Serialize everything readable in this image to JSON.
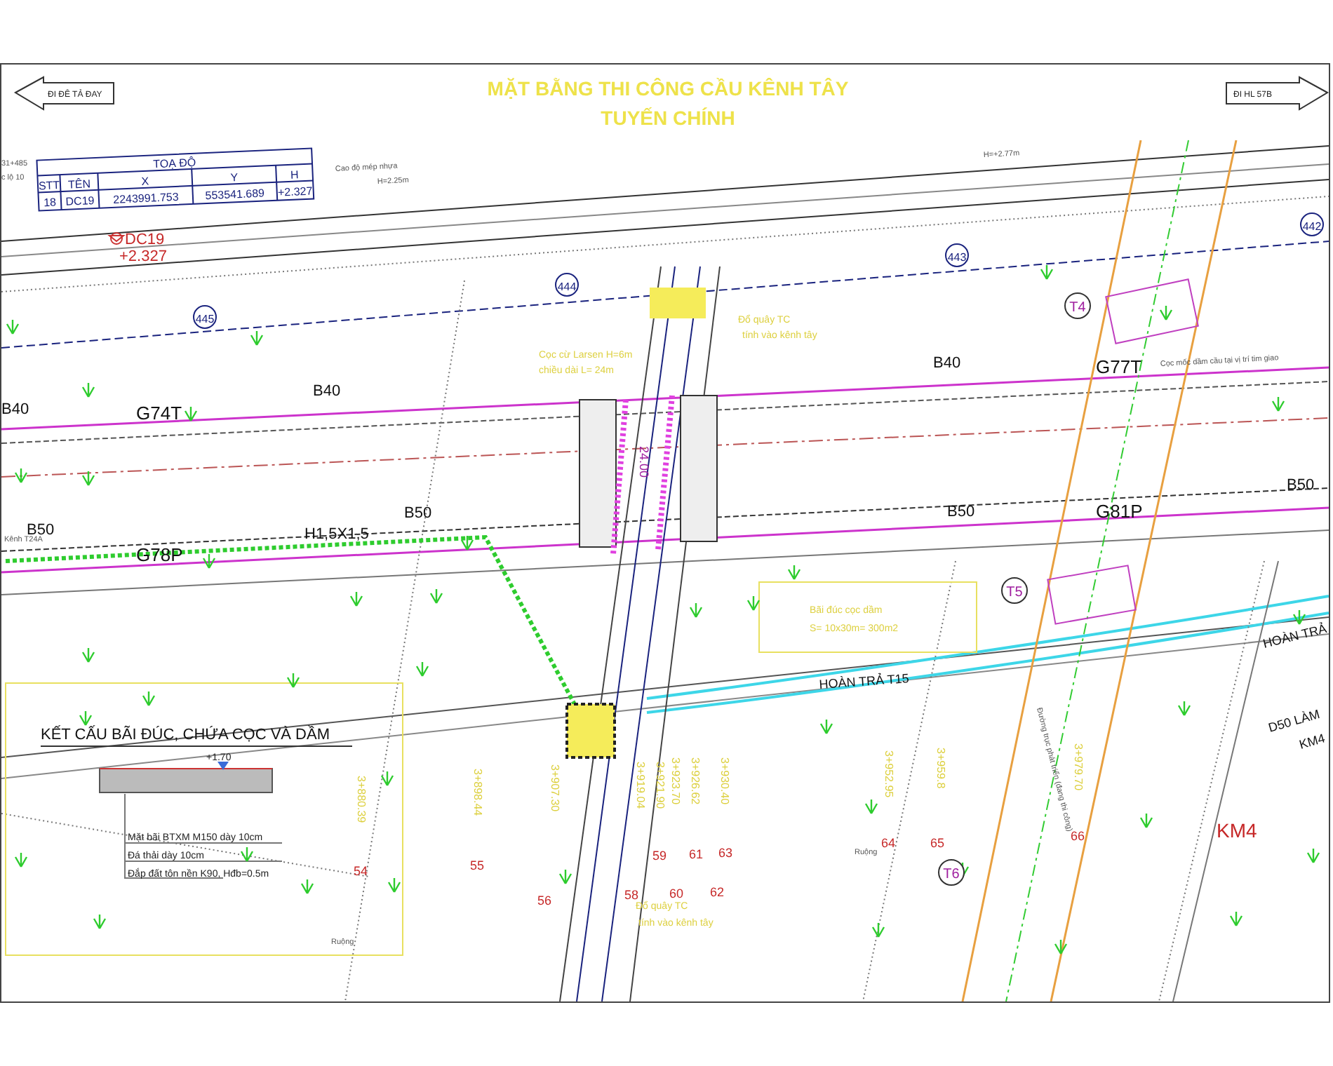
{
  "title": {
    "main": "MẶT BẰNG THI CÔNG CẦU KÊNH TÂY",
    "sub": "TUYẾN CHÍNH"
  },
  "direction_signs": [
    {
      "label": "ĐI ĐÊ TẢ ĐAY",
      "kind": "left"
    },
    {
      "label": "ĐI HL 57B",
      "kind": "right"
    }
  ],
  "coordinate_table": {
    "title": "TOẠ ĐỘ",
    "columns": [
      "STT",
      "TÊN",
      "X",
      "Y",
      "H"
    ],
    "rows": [
      [
        "18",
        "DC19",
        "2243991.753",
        "553541.689",
        "+2.327"
      ]
    ]
  },
  "survey_point": {
    "name": "DC19",
    "elevation": "+2.327"
  },
  "notes": [
    "31+485",
    "c lộ 10",
    "Cao độ mép nhựa",
    "H=2.25m",
    "H=+2.77m",
    "Cọc mốc dầm cầu tại vị trí tim giao",
    "Kênh T24A",
    "Ruộng",
    "Ruộng",
    "Đường trục phát triển (đang thi công)"
  ],
  "markers": [
    {
      "label": "445",
      "kind": "survey"
    },
    {
      "label": "444",
      "kind": "survey"
    },
    {
      "label": "443",
      "kind": "survey"
    },
    {
      "label": "442",
      "kind": "survey"
    },
    {
      "label": "T4",
      "kind": "pier"
    },
    {
      "label": "T5",
      "kind": "pier"
    },
    {
      "label": "T6",
      "kind": "pier"
    }
  ],
  "culvert_labels": [
    "B40",
    "G74T",
    "B40",
    "B40",
    "G77T",
    "B50",
    "G78P",
    "H1,5X1,5",
    "B50",
    "B50",
    "G81P",
    "B50"
  ],
  "site_notes": [
    "Cọc cừ Larsen H=6m",
    "chiều dài L= 24m",
    "Đổ quây TC",
    "tính vào kênh tây",
    "Bãi đúc cọc dầm",
    "S= 10x30m= 300m2",
    "Đổ quây TC",
    "tính vào kênh tây"
  ],
  "road_labels": [
    "HOÀN TRẢ T15",
    "HOÀN TRẢ",
    "D50 LÀM",
    "KM4"
  ],
  "span_length": "24.00",
  "chainages": [
    "3+880.39",
    "3+898.44",
    "3+907.30",
    "3+919.04",
    "3+921.90",
    "3+923.70",
    "3+926.62",
    "3+930.40",
    "3+952.95",
    "3+959.8",
    "3+979.70"
  ],
  "point_numbers": [
    "54",
    "55",
    "56",
    "58",
    "59",
    "60",
    "61",
    "62",
    "63",
    "64",
    "65",
    "66"
  ],
  "kilometre_post": "KM4",
  "legend": {
    "title": "KẾT CẤU BÃI ĐÚC, CHỨA CỌC VÀ DẦM",
    "elevation": "+1.70",
    "layers": [
      "Mặt bãi BTXM M150 dày 10cm",
      "Đá thải dày 10cm",
      "Đắp đất tôn nền K90, Hđb=0.5m"
    ]
  }
}
